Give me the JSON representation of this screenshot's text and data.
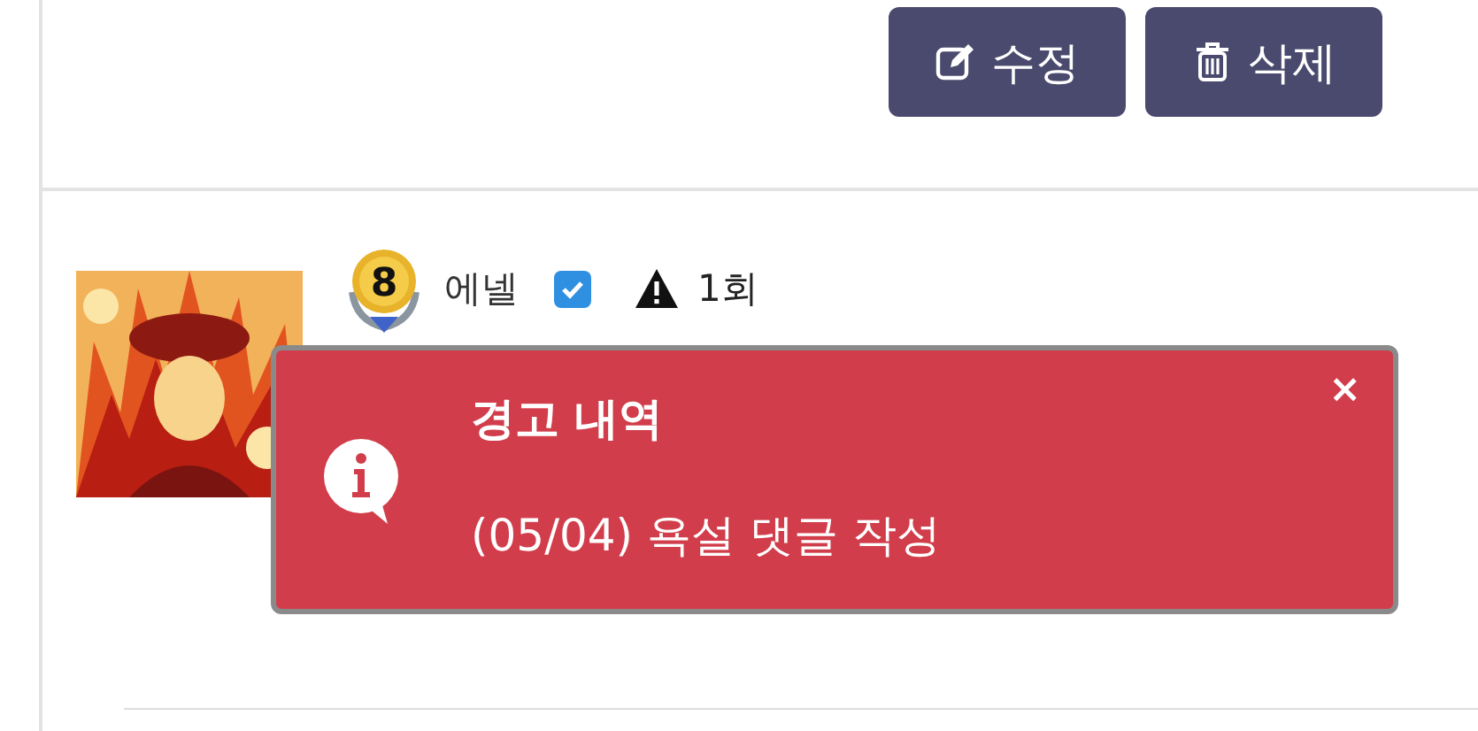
{
  "actions": [
    {
      "kind": "edit",
      "label": "수정"
    },
    {
      "kind": "delete",
      "label": "삭제"
    }
  ],
  "user": {
    "level": "8",
    "name": "에넬",
    "verified": true,
    "warning_count": "1회"
  },
  "toast": {
    "title": "경고 내역",
    "message": "(05/04) 욕설 댓글 작성",
    "close": "×"
  }
}
